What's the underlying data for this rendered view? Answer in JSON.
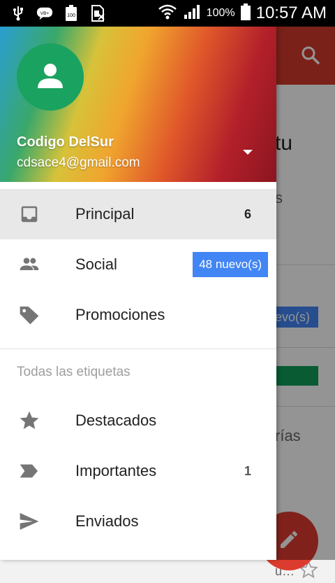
{
  "status_bar": {
    "battery_percent": "100%",
    "time": "10:57 AM",
    "icons": [
      "usb-icon",
      "voicemail-icon",
      "battery-small-icon",
      "no-sim-icon",
      "wifi-icon",
      "signal-icon",
      "battery-icon"
    ]
  },
  "colors": {
    "toolbar": "#d33a2b",
    "avatar": "#1aa260",
    "new_badge": "#4285f4",
    "fab": "#dc3c2f"
  },
  "background": {
    "text1": "tu",
    "text2": "s",
    "badge": "evo(s)",
    "text3": "rías",
    "text4": "u…"
  },
  "drawer": {
    "account": {
      "name": "Codigo DelSur",
      "email": "cdsace4@gmail.com"
    },
    "items": [
      {
        "label": "Principal",
        "count": "6",
        "icon": "inbox-icon"
      },
      {
        "label": "Social",
        "badge": "48 nuevo(s)",
        "icon": "people-icon"
      },
      {
        "label": "Promociones",
        "icon": "tag-icon"
      }
    ],
    "section_header": "Todas las etiquetas",
    "labels": [
      {
        "label": "Destacados",
        "icon": "star-icon"
      },
      {
        "label": "Importantes",
        "count": "1",
        "icon": "important-icon"
      },
      {
        "label": "Enviados",
        "icon": "send-icon"
      }
    ]
  }
}
